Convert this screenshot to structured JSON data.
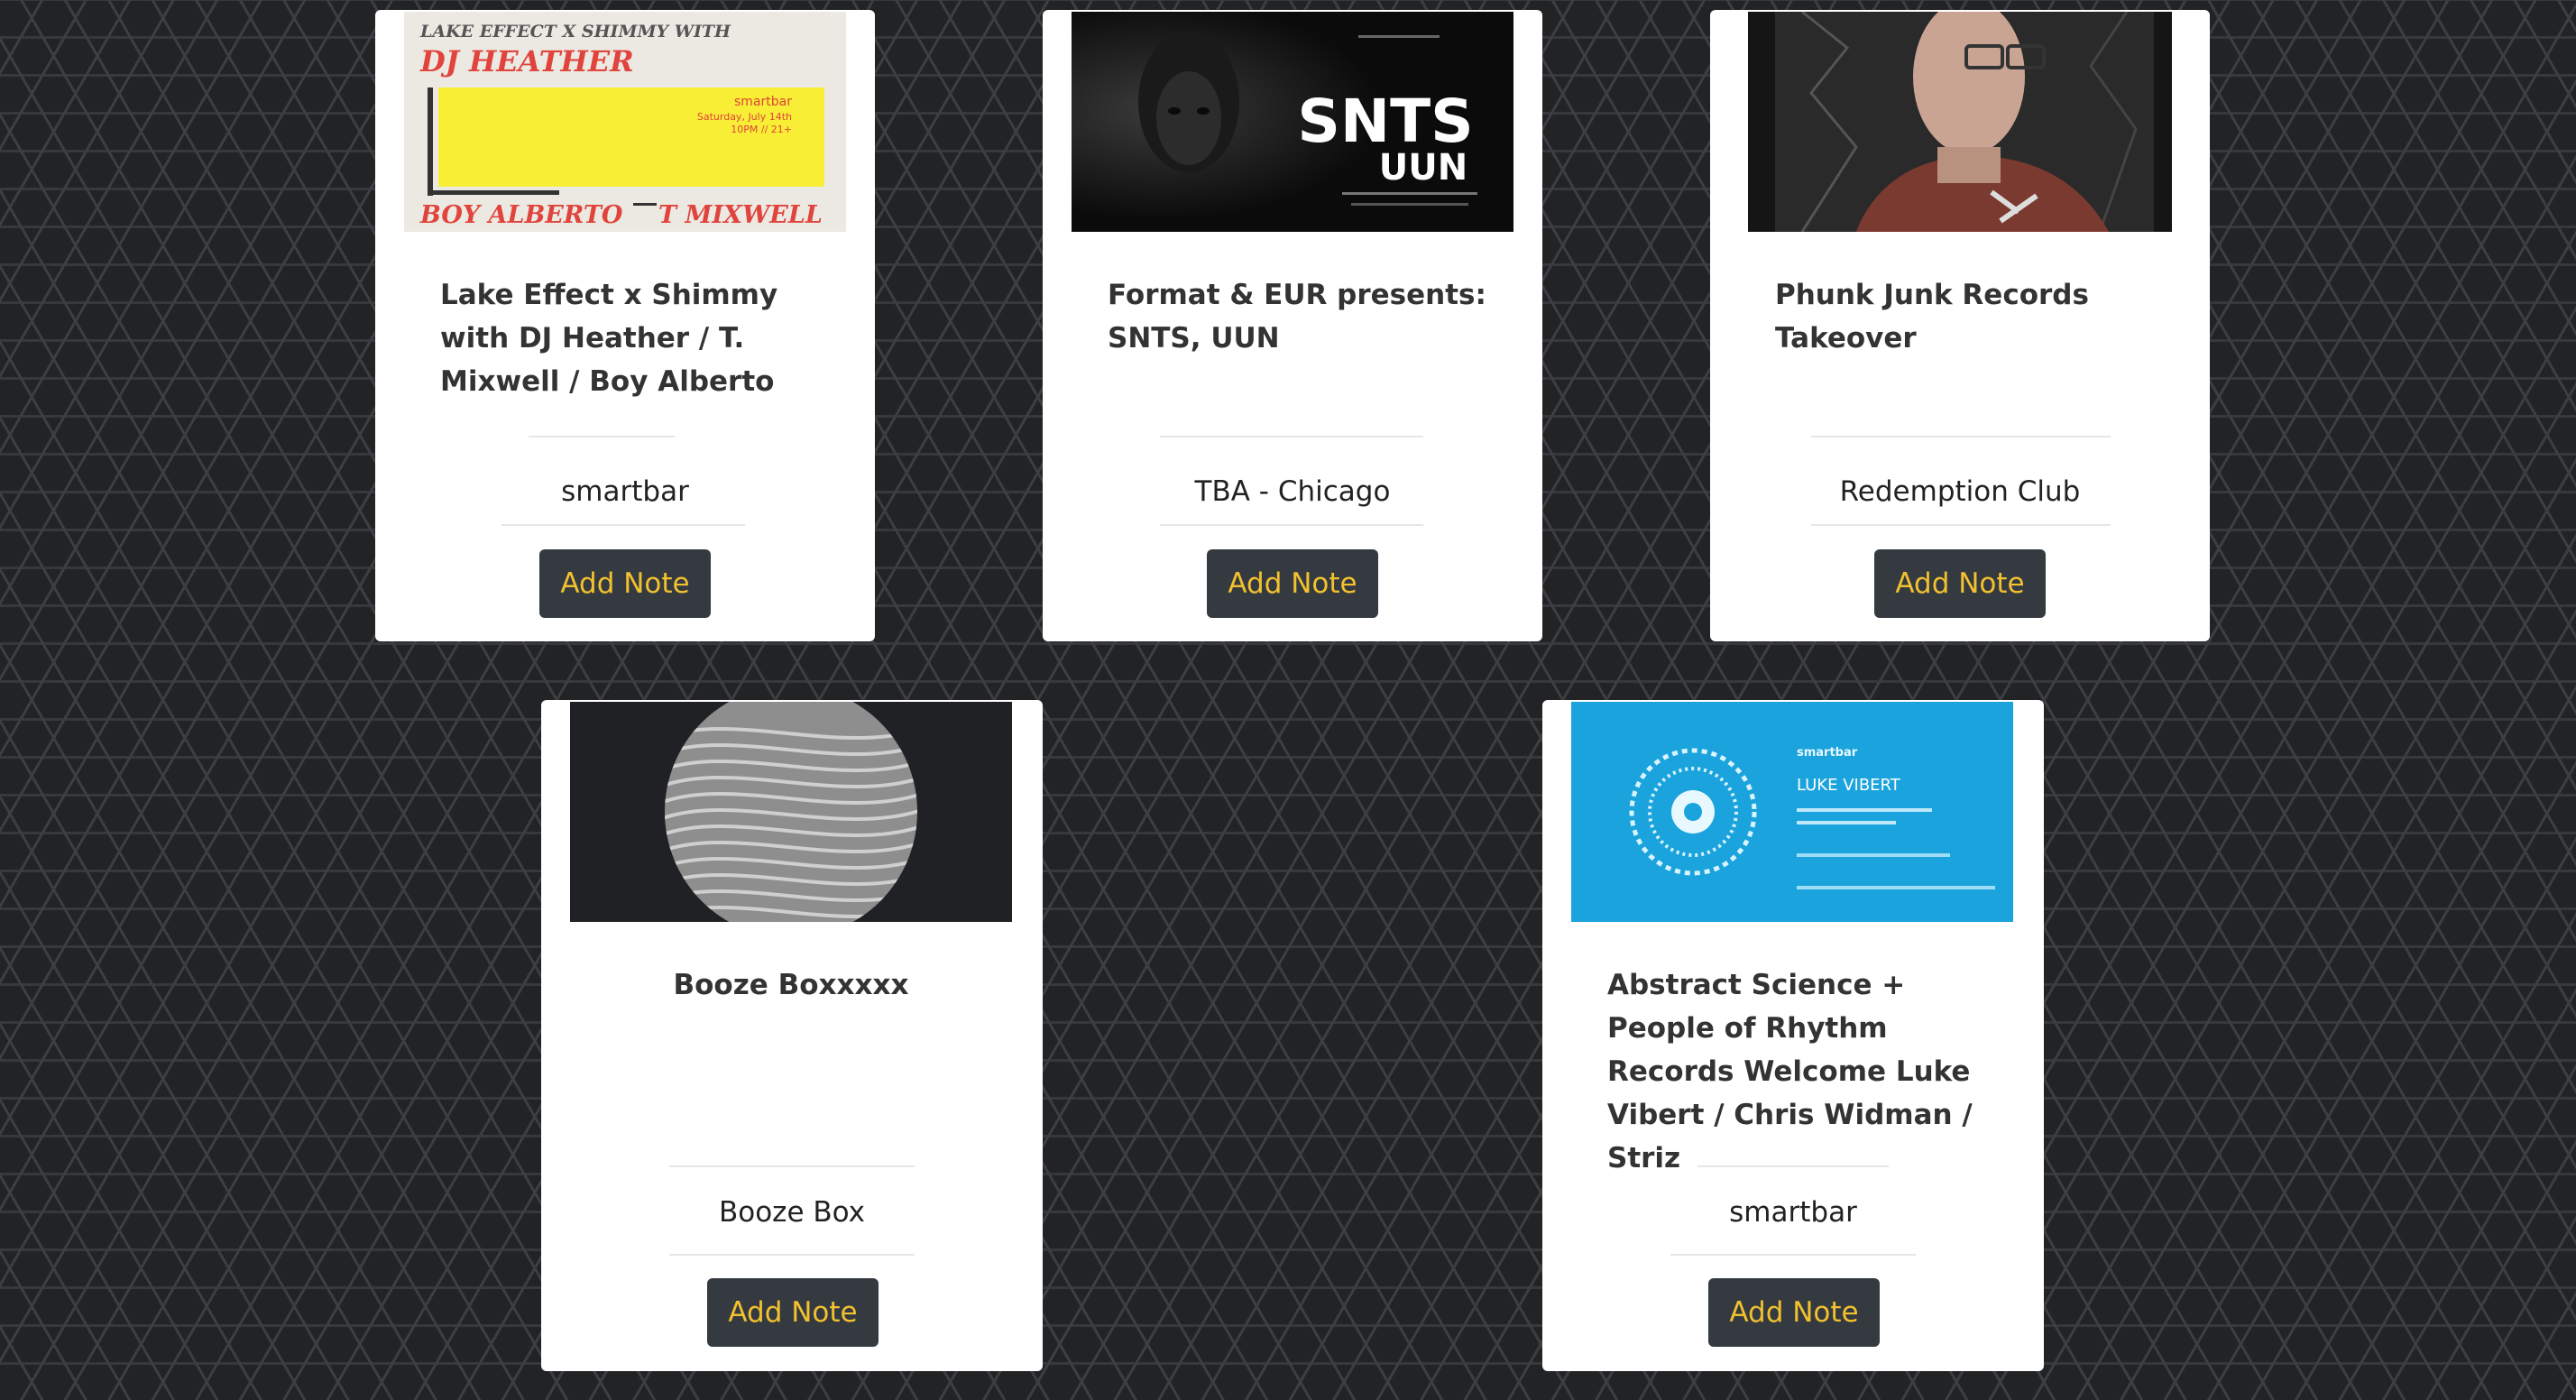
{
  "events": [
    {
      "title": "Lake Effect x Shimmy with DJ Heather / T. Mixwell / Boy Alberto",
      "venue": "smartbar",
      "button": "Add Note",
      "poster": {
        "top_line": "LAKE EFFECT X SHIMMY WITH",
        "headliner": "DJ HEATHER",
        "venue_small": "smartbar",
        "date_small": "Saturday, July 14th",
        "time_small": "10PM // 21+",
        "bottom_left": "BOY ALBERTO",
        "bottom_right": "T MIXWELL"
      }
    },
    {
      "title": "Format & EUR presents: SNTS, UUN",
      "venue": "TBA - Chicago",
      "button": "Add Note",
      "poster": {
        "line1": "SNTS",
        "line2": "UUN"
      }
    },
    {
      "title": "Phunk Junk Records Takeover",
      "venue": "Redemption Club",
      "button": "Add Note",
      "poster": {}
    },
    {
      "title": "Booze Boxxxxx",
      "venue": "Booze Box",
      "button": "Add Note",
      "poster": {}
    },
    {
      "title": "Abstract Science + People of Rhythm Records Welcome Luke Vibert / Chris Widman / Striz",
      "venue": "smartbar",
      "button": "Add Note",
      "poster": {
        "brand": "smartbar",
        "headliner": "LUKE VIBERT"
      }
    }
  ],
  "colors": {
    "background": "#222325",
    "card": "#ffffff",
    "button_bg": "#343a40",
    "button_text": "#f2c12e"
  }
}
